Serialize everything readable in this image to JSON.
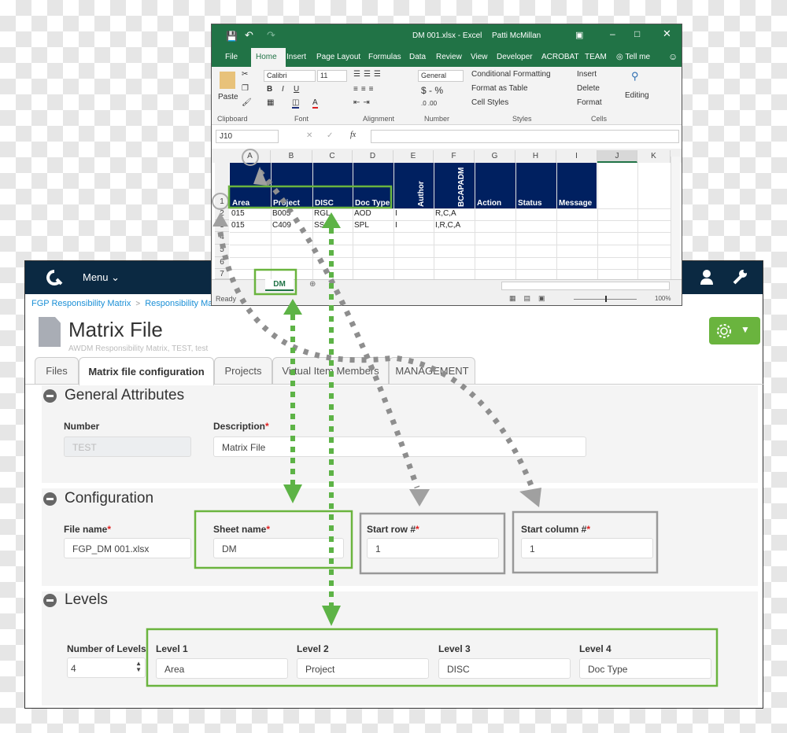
{
  "app": {
    "menu_label": "Menu",
    "breadcrumb": [
      "FGP Responsibility Matrix",
      "Responsibility Matrix"
    ],
    "page_title": "Matrix File",
    "page_subtitle": "AWDM Responsibility Matrix, TEST, test",
    "tabs": [
      "Files",
      "Matrix file configuration",
      "Projects",
      "Virtual Item Members",
      "MANAGEMENT"
    ],
    "active_tab": "Matrix file configuration",
    "general": {
      "title": "General Attributes",
      "number_label": "Number",
      "number_value": "TEST",
      "description_label": "Description",
      "description_value": "Matrix File"
    },
    "configuration": {
      "title": "Configuration",
      "file_name_label": "File name",
      "file_name_value": "FGP_DM 001.xlsx",
      "sheet_name_label": "Sheet name",
      "sheet_name_value": "DM",
      "start_row_label": "Start row #",
      "start_row_value": "1",
      "start_col_label": "Start column #",
      "start_col_value": "1"
    },
    "levels": {
      "title": "Levels",
      "count_label": "Number of Levels",
      "count_value": "4",
      "items": [
        {
          "label": "Level 1",
          "value": "Area"
        },
        {
          "label": "Level 2",
          "value": "Project"
        },
        {
          "label": "Level 3",
          "value": "DISC"
        },
        {
          "label": "Level 4",
          "value": "Doc Type"
        }
      ]
    },
    "required_mark": "*",
    "colors": {
      "nav": "#0b2942",
      "accent": "#6ab43e",
      "link": "#1a8fd6"
    }
  },
  "excel": {
    "title": "DM 001.xlsx  -  Excel",
    "user": "Patti McMillan",
    "ribbon_tabs": [
      "File",
      "Home",
      "Insert",
      "Page Layout",
      "Formulas",
      "Data",
      "Review",
      "View",
      "Developer",
      "ACROBAT",
      "TEAM",
      "Tell me"
    ],
    "font_name": "Calibri",
    "font_size": "11",
    "number_format": "General",
    "styles": [
      "Conditional Formatting",
      "Format as Table",
      "Cell Styles"
    ],
    "cells_group": [
      "Insert",
      "Delete",
      "Format"
    ],
    "editing": "Editing",
    "paste": "Paste",
    "groups": [
      "Clipboard",
      "Font",
      "Alignment",
      "Number",
      "Styles",
      "Cells"
    ],
    "name_box": "J10",
    "fx": "fx",
    "columns": [
      "A",
      "B",
      "C",
      "D",
      "E",
      "F",
      "G",
      "H",
      "I",
      "J",
      "K"
    ],
    "rows": [
      "1",
      "2",
      "3",
      "4",
      "5",
      "6",
      "7"
    ],
    "headers": [
      "Area",
      "Project",
      "DISC",
      "Doc Type",
      "Author",
      "BCAPADM",
      "Action",
      "Status",
      "Message"
    ],
    "data": [
      [
        "015",
        "B005",
        "RGL",
        "AOD",
        "I",
        "R,C,A"
      ],
      [
        "015",
        "C409",
        "SSS",
        "SPL",
        "I",
        "I,R,C,A"
      ]
    ],
    "sheet_tab": "DM",
    "status": "Ready",
    "zoom": "100%",
    "colors": {
      "title_bar": "#217346",
      "header_fill": "#002060"
    }
  }
}
